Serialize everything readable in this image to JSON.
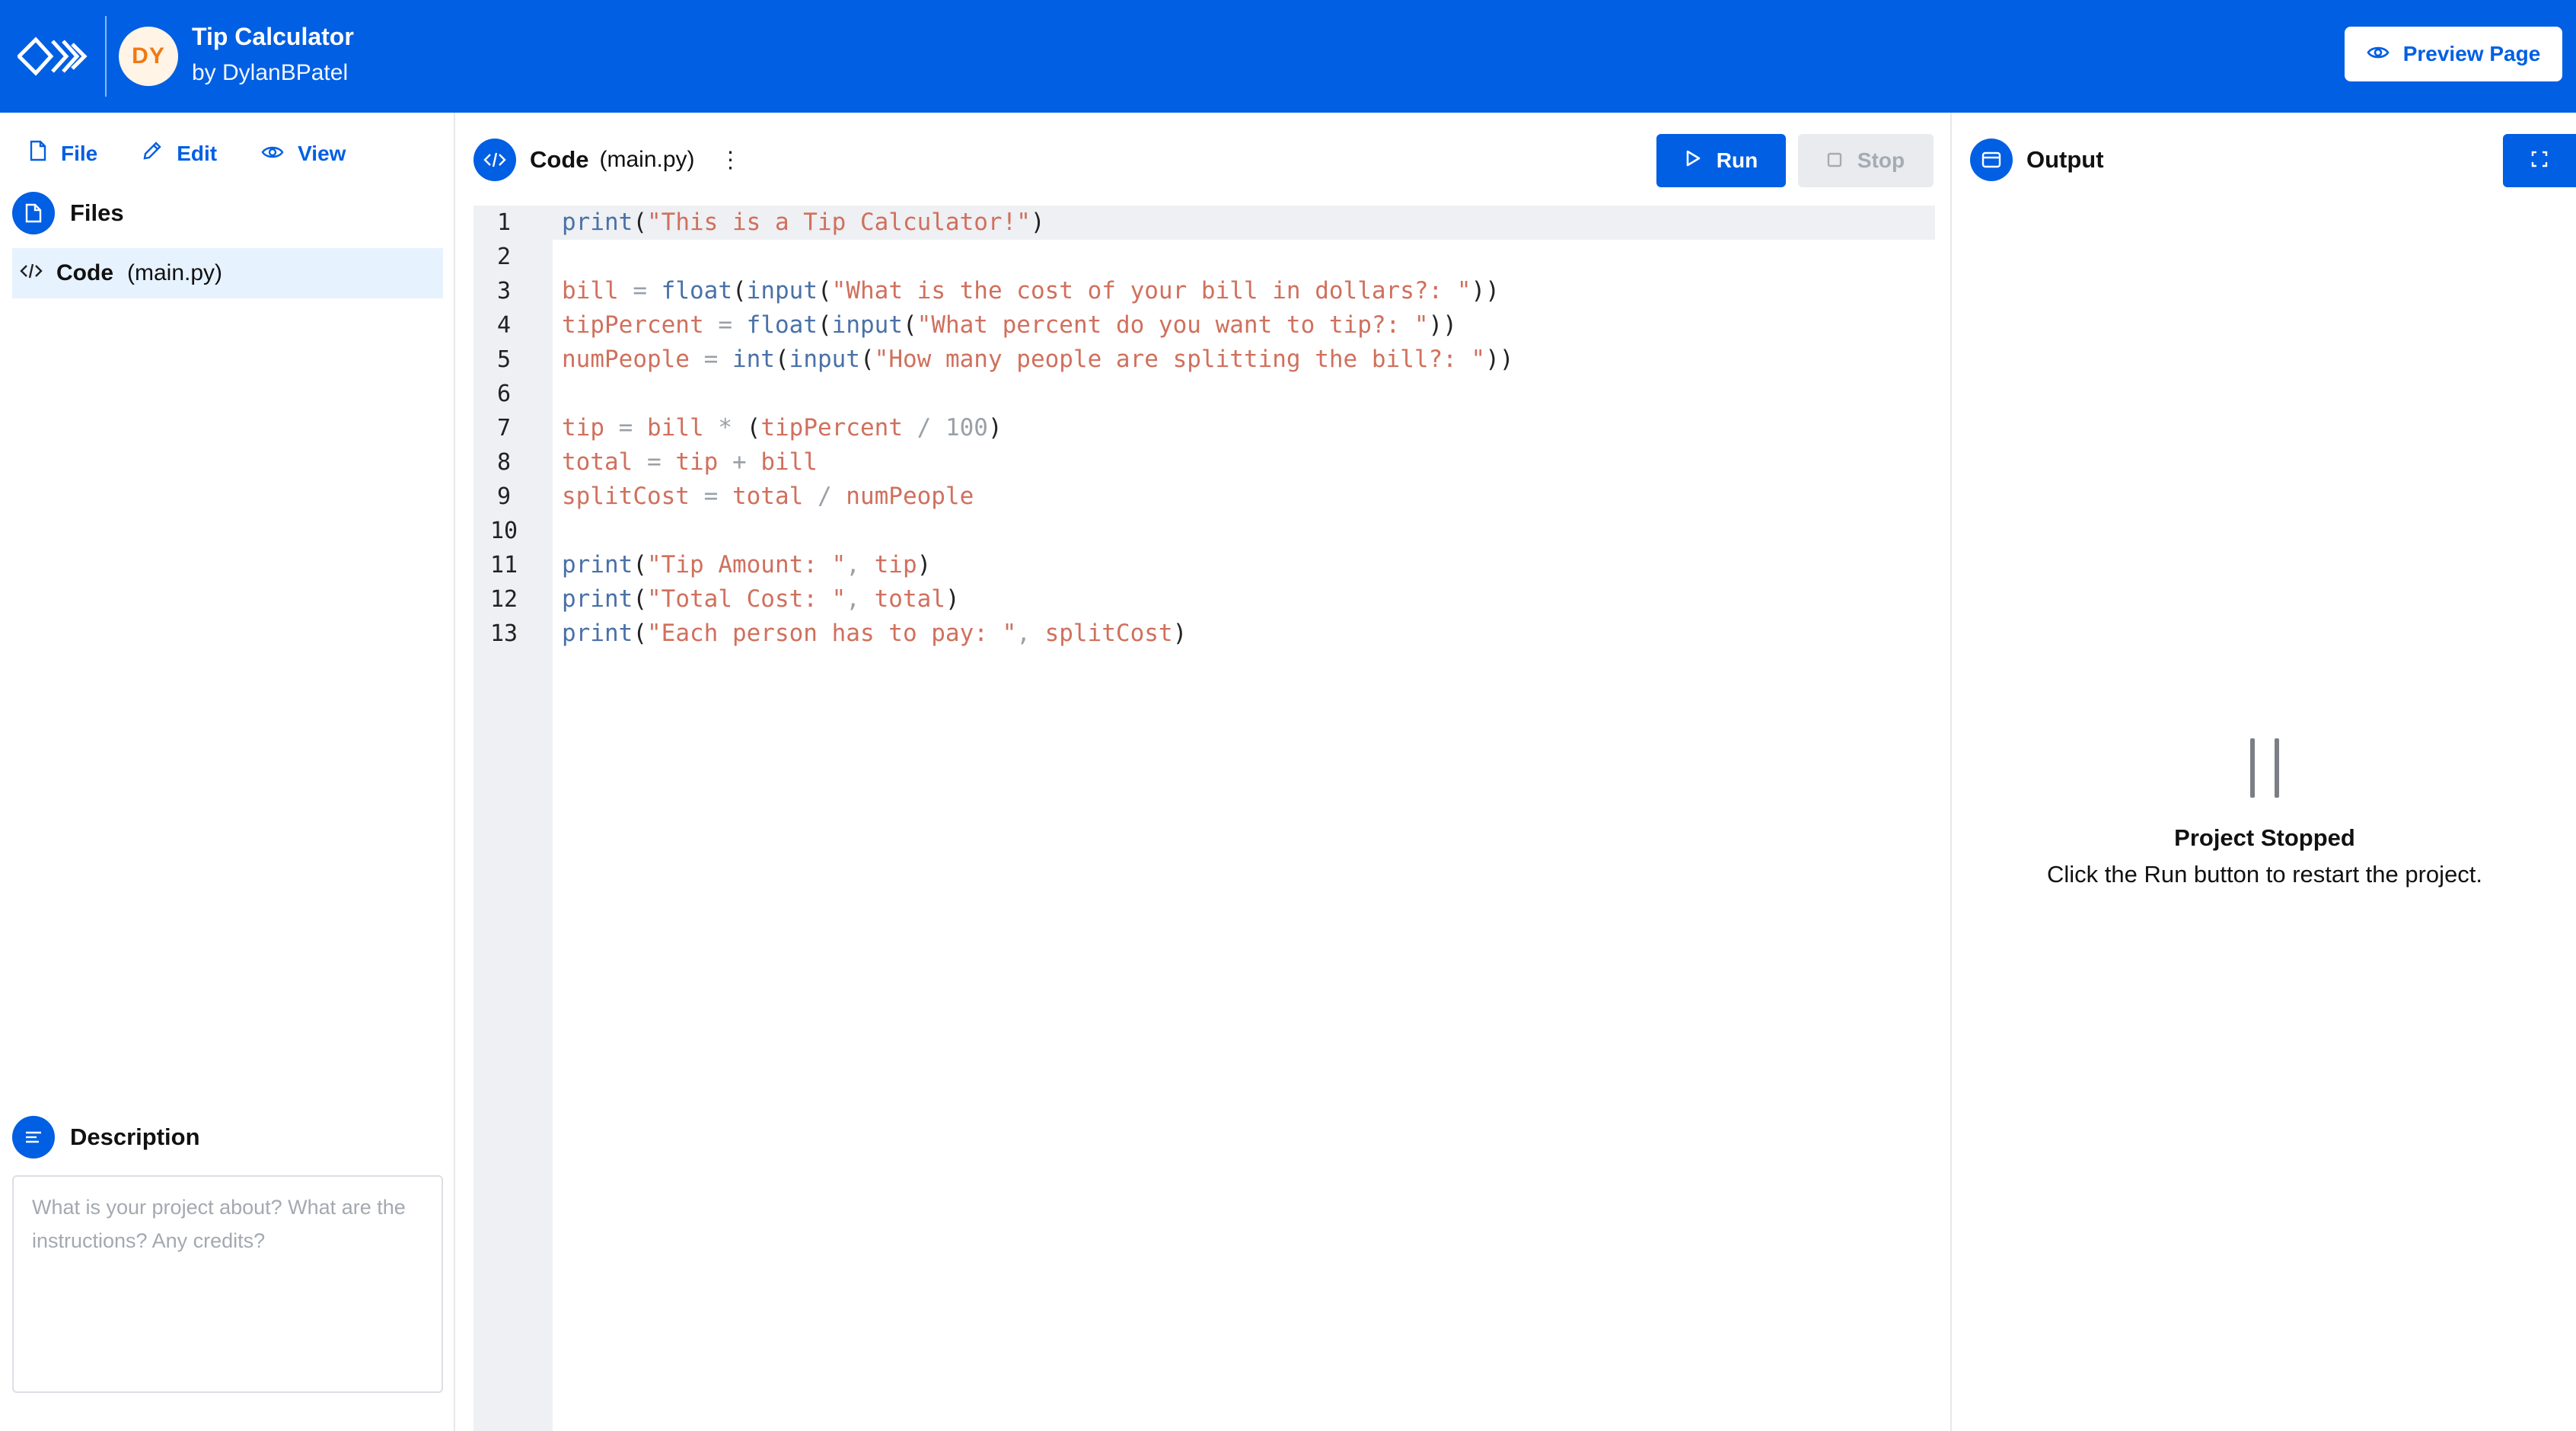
{
  "header": {
    "avatar_initials": "DY",
    "project_title": "Tip Calculator",
    "author": "by DylanBPatel",
    "preview_label": "Preview Page"
  },
  "menu": {
    "file": "File",
    "edit": "Edit",
    "view": "View"
  },
  "files": {
    "title": "Files",
    "items": [
      {
        "label": "Code",
        "filename": "(main.py)"
      }
    ]
  },
  "description": {
    "title": "Description",
    "placeholder": "What is your project about? What are the instructions? Any credits?"
  },
  "editor": {
    "label": "Code",
    "filename": "(main.py)",
    "run_label": "Run",
    "stop_label": "Stop",
    "line_numbers": [
      "1",
      "2",
      "3",
      "4",
      "5",
      "6",
      "7",
      "8",
      "9",
      "10",
      "11",
      "12",
      "13"
    ],
    "lines": [
      "print(\"This is a Tip Calculator!\")",
      "",
      "bill = float(input(\"What is the cost of your bill in dollars?: \"))",
      "tipPercent = float(input(\"What percent do you want to tip?: \"))",
      "numPeople = int(input(\"How many people are splitting the bill?: \"))",
      "",
      "tip = bill * (tipPercent / 100)",
      "total = tip + bill",
      "splitCost = total / numPeople",
      "",
      "print(\"Tip Amount: \", tip)",
      "print(\"Total Cost: \", total)",
      "print(\"Each person has to pay: \", splitCost)"
    ]
  },
  "output": {
    "title": "Output",
    "status_title": "Project Stopped",
    "status_message": "Click the Run button to restart the project."
  },
  "colors": {
    "accent": "#015fe3",
    "avatar_bg": "#fff4e6",
    "avatar_text": "#f07a12",
    "code_string": "#d0705d",
    "code_function": "#4a71a8",
    "selected_file_bg": "#e6f2fd"
  }
}
